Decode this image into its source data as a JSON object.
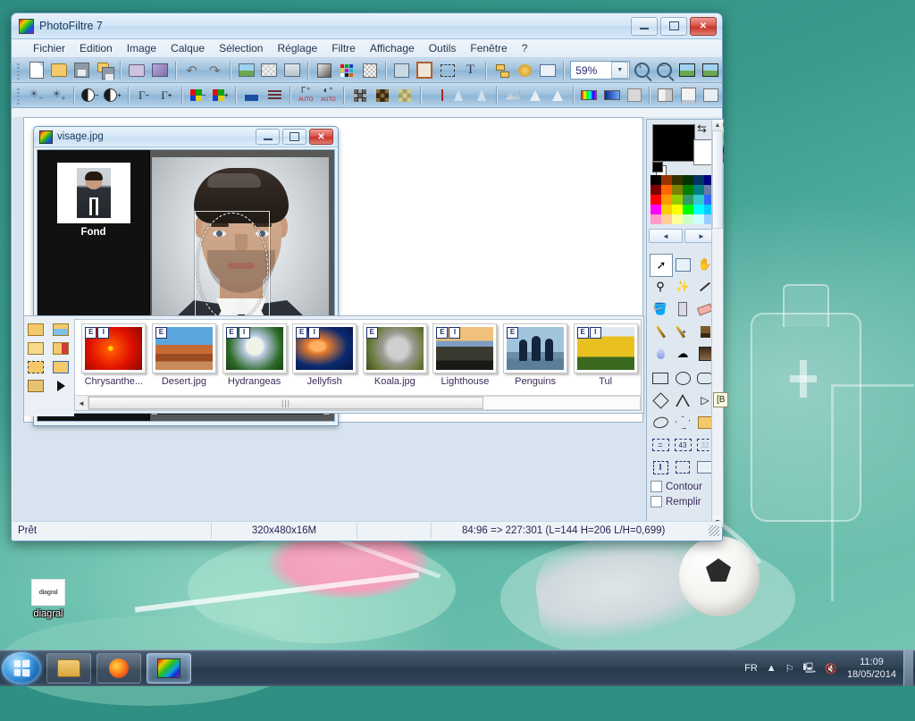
{
  "desktop": {
    "icon": {
      "label": "diagral",
      "icon_text": "diagral"
    }
  },
  "taskbar": {
    "start_name": "start-orb",
    "buttons": [
      {
        "name": "explorer",
        "icon": "folder-icon",
        "active": false
      },
      {
        "name": "firefox",
        "icon": "firefox-icon",
        "active": false
      },
      {
        "name": "photofiltre",
        "icon": "photofiltre-icon",
        "active": true
      }
    ],
    "tray": {
      "language": "FR",
      "show_hidden": "show-hidden-icon",
      "flag": "flag-icon",
      "network": "network-icon",
      "volume": "volume-muted-icon",
      "time": "11:09",
      "date": "18/05/2014"
    }
  },
  "app": {
    "title": "PhotoFiltre 7",
    "window_buttons": {
      "minimize": "minimize",
      "maximize": "maximize",
      "close": "close"
    },
    "menu": [
      "Fichier",
      "Edition",
      "Image",
      "Calque",
      "Sélection",
      "Réglage",
      "Filtre",
      "Affichage",
      "Outils",
      "Fenêtre",
      "?"
    ],
    "toolbar1": [
      "new-icon",
      "open-icon",
      "save-icon",
      "save-as-icon",
      "sep",
      "print-icon",
      "print-preview-icon",
      "sep",
      "undo-icon",
      "redo-icon",
      "sep",
      "copy-image-icon",
      "paste-image-icon",
      "duplicate-icon",
      "sep",
      "gradient-icon",
      "palette-icon",
      "transparency-icon",
      "sep",
      "manual-select-icon",
      "frame-icon",
      "selection-icon",
      "text-icon",
      "sep",
      "layers-icon",
      "module-icon",
      "preferences-icon"
    ],
    "zoom": {
      "value": "59%",
      "dropdown": "chevron-down-icon"
    },
    "toolbar1b": [
      "zoom-in-icon",
      "zoom-out-icon",
      "fit-icon",
      "actual-size-icon"
    ],
    "toolbar2": [
      "brightness-down-icon",
      "brightness-up-icon",
      "sep",
      "contrast-down-icon",
      "contrast-up-icon",
      "sep",
      "gamma-down-icon",
      "gamma-up-icon",
      "sep",
      "saturation-down-icon",
      "saturation-up-icon",
      "sep",
      "histogram-icon",
      "levels-icon",
      "sep",
      "auto-gamma-icon",
      "auto-contrast-icon",
      "sep",
      "grid-dark-icon",
      "grid-mid-icon",
      "grid-light-icon",
      "sep",
      "mask-icon",
      "blur-icon",
      "sharpen-icon",
      "sep",
      "emboss-icon",
      "noise-icon",
      "relief-icon",
      "sep",
      "hue-shift-icon",
      "gradient-map-icon",
      "red-eye-icon",
      "sep",
      "book-icon",
      "split-icon",
      "export-icon"
    ]
  },
  "image_window": {
    "title": "visage.jpg",
    "window_buttons": {
      "minimize": "minimize",
      "maximize": "maximize",
      "close": "close"
    },
    "layer": {
      "name": "Fond"
    },
    "selection": {
      "shape": "ellipse"
    }
  },
  "browser": {
    "tool_icons": [
      "open-folder-icon",
      "folder-image-icon",
      "folder-forward-icon",
      "folder-save-icon",
      "folder-select-icon",
      "folder-frame-icon",
      "folder-trash-icon",
      "play-icon"
    ],
    "thumbnails": [
      {
        "name": "Chrysanthe...",
        "badges": [
          "E",
          "I"
        ],
        "color": "chrysanthemum"
      },
      {
        "name": "Desert.jpg",
        "badges": [
          "E"
        ],
        "color": "desert"
      },
      {
        "name": "Hydrangeas",
        "badges": [
          "E",
          "I"
        ],
        "color": "hydrangeas"
      },
      {
        "name": "Jellyfish",
        "badges": [
          "E",
          "I"
        ],
        "color": "jellyfish"
      },
      {
        "name": "Koala.jpg",
        "badges": [
          "E"
        ],
        "color": "koala"
      },
      {
        "name": "Lighthouse",
        "badges": [
          "E",
          "I"
        ],
        "color": "lighthouse"
      },
      {
        "name": "Penguins",
        "badges": [
          "E"
        ],
        "color": "penguins"
      },
      {
        "name": "Tul",
        "badges": [
          "E",
          "I"
        ],
        "color": "tulips"
      }
    ],
    "scrollbar": {
      "grip": "|||"
    }
  },
  "palette": {
    "foreground_color": "#000000",
    "background_color": "#ffffff",
    "swap_icon": "swap-arrows-icon",
    "prev_label": "◄",
    "next_label": "►",
    "swatches": [
      "#000000",
      "#993300",
      "#333300",
      "#003300",
      "#003366",
      "#000080",
      "#800000",
      "#ff6600",
      "#808000",
      "#008000",
      "#008080",
      "#6a7aa8",
      "#ff0000",
      "#ff9900",
      "#99cc00",
      "#339966",
      "#33cccc",
      "#3366ff",
      "#ff00ff",
      "#ffcc00",
      "#ffff00",
      "#00ff00",
      "#00ffff",
      "#00ccff",
      "#ff99cc",
      "#ffcc99",
      "#ffff99",
      "#ccffcc",
      "#ccffff",
      "#99ccff"
    ],
    "swatches_extra": [
      "#333399",
      "#7b7b9b",
      "#993366",
      "#a050a0",
      "#9966ff",
      "#cc99ff"
    ],
    "tools": [
      "arrow-select-icon",
      "clone-pattern-icon",
      "hand-icon",
      "eyedropper-icon",
      "magic-wand-icon",
      "line-icon",
      "paint-bucket-icon",
      "spray-icon",
      "eraser-icon",
      "paintbrush-icon",
      "brush-plus-icon",
      "stamp-icon",
      "water-drop-icon",
      "smudge-icon",
      "artistic-icon"
    ],
    "shapes": [
      "rectangle-icon",
      "ellipse-icon",
      "rounded-rect-icon",
      "diamond-icon",
      "triangle-icon",
      "arrow-shape-icon",
      "lasso-icon",
      "polygon-icon",
      "folder-shape-icon",
      "ratio-free-icon",
      "ratio-43-icon",
      "ratio-32-icon",
      "text-select-icon",
      "transform-icon",
      "options-icon"
    ],
    "checkboxes": [
      {
        "label": "Contour",
        "checked": false
      },
      {
        "label": "Remplir",
        "checked": false
      }
    ],
    "tooltip": "[B"
  },
  "statusbar": {
    "state": "Prêt",
    "dimensions": "320x480x16M",
    "coordinates": "84:96 => 227:301 (L=144  H=206  L/H=0,699)"
  }
}
